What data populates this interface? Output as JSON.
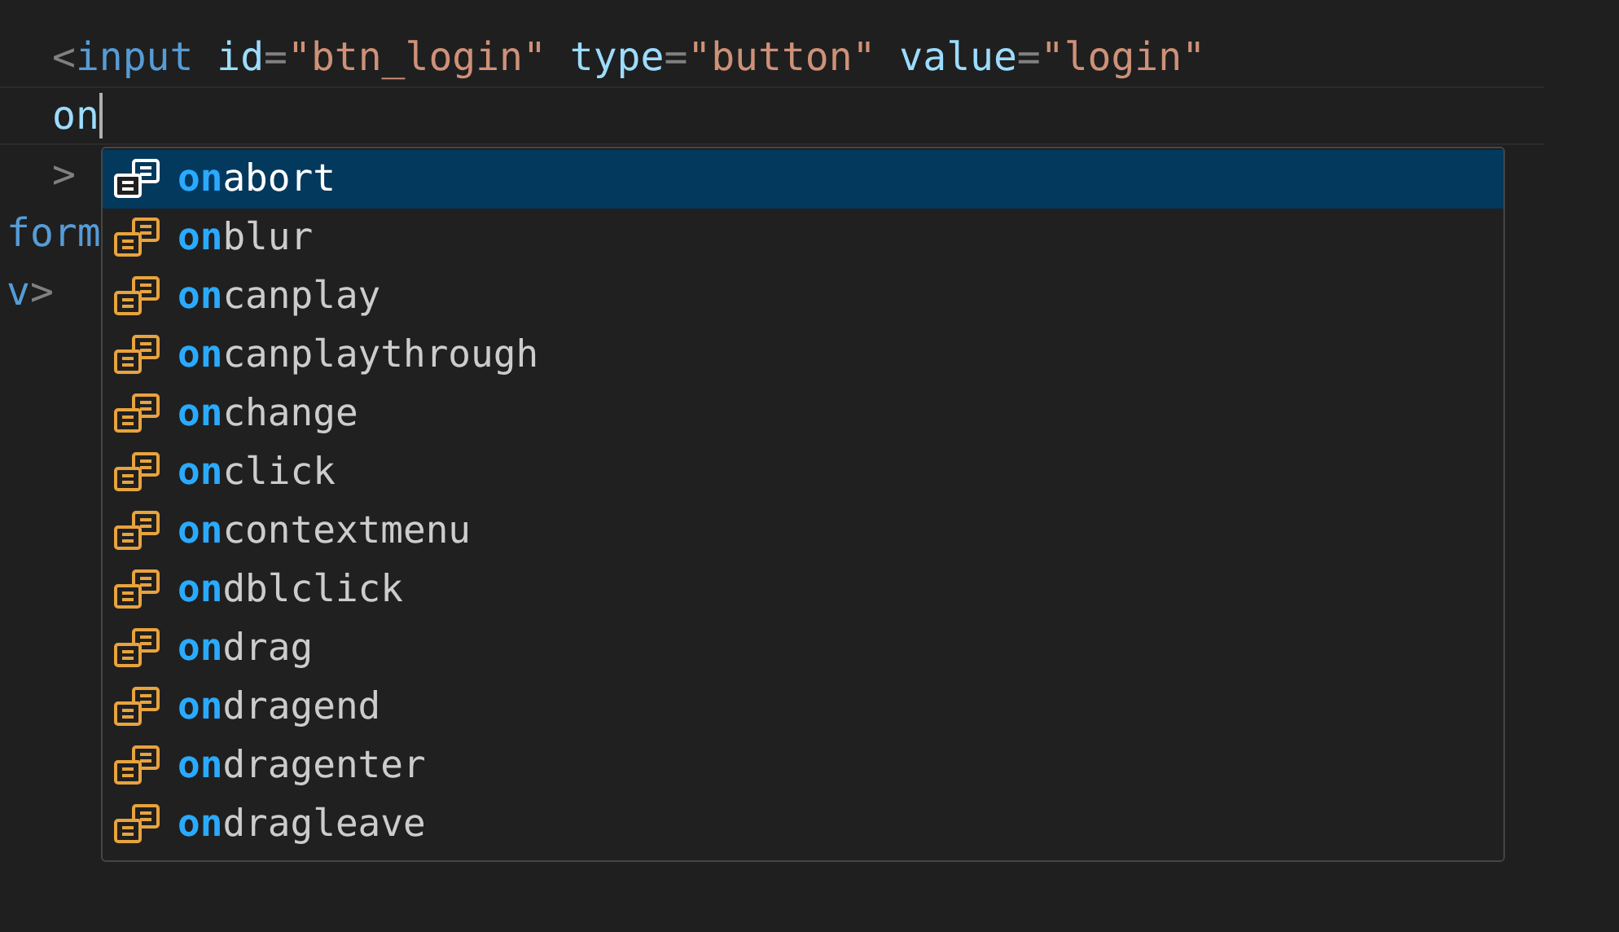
{
  "editor": {
    "lines": [
      {
        "current": false,
        "kind": "indented",
        "tokens": [
          {
            "kind": "punct",
            "text": "<"
          },
          {
            "kind": "tag",
            "text": "input"
          },
          {
            "kind": "attr",
            "text": "id"
          },
          {
            "kind": "punct",
            "text": "="
          },
          {
            "kind": "string",
            "text": "\"btn_login\""
          },
          {
            "kind": "attr",
            "text": "type"
          },
          {
            "kind": "punct",
            "text": "="
          },
          {
            "kind": "string",
            "text": "\"button\""
          },
          {
            "kind": "attr",
            "text": "value"
          },
          {
            "kind": "punct",
            "text": "="
          },
          {
            "kind": "string",
            "text": "\"login\""
          }
        ]
      },
      {
        "current": true,
        "kind": "indented",
        "tokens": [
          {
            "kind": "attr",
            "text": "on"
          }
        ]
      },
      {
        "current": false,
        "kind": "indented",
        "tokens": [
          {
            "kind": "punct",
            "text": ">"
          }
        ]
      },
      {
        "current": false,
        "kind": "outer",
        "tokens": [
          {
            "kind": "tag",
            "text": "form"
          }
        ]
      },
      {
        "current": false,
        "kind": "outer",
        "tokens": [
          {
            "kind": "tag",
            "text": "v"
          },
          {
            "kind": "punct",
            "text": ">"
          }
        ]
      }
    ]
  },
  "suggestions": [
    {
      "match": "on",
      "rest": "abort",
      "selected": true
    },
    {
      "match": "on",
      "rest": "blur",
      "selected": false
    },
    {
      "match": "on",
      "rest": "canplay",
      "selected": false
    },
    {
      "match": "on",
      "rest": "canplaythrough",
      "selected": false
    },
    {
      "match": "on",
      "rest": "change",
      "selected": false
    },
    {
      "match": "on",
      "rest": "click",
      "selected": false
    },
    {
      "match": "on",
      "rest": "contextmenu",
      "selected": false
    },
    {
      "match": "on",
      "rest": "dblclick",
      "selected": false
    },
    {
      "match": "on",
      "rest": "drag",
      "selected": false
    },
    {
      "match": "on",
      "rest": "dragend",
      "selected": false
    },
    {
      "match": "on",
      "rest": "dragenter",
      "selected": false
    },
    {
      "match": "on",
      "rest": "dragleave",
      "selected": false
    }
  ]
}
